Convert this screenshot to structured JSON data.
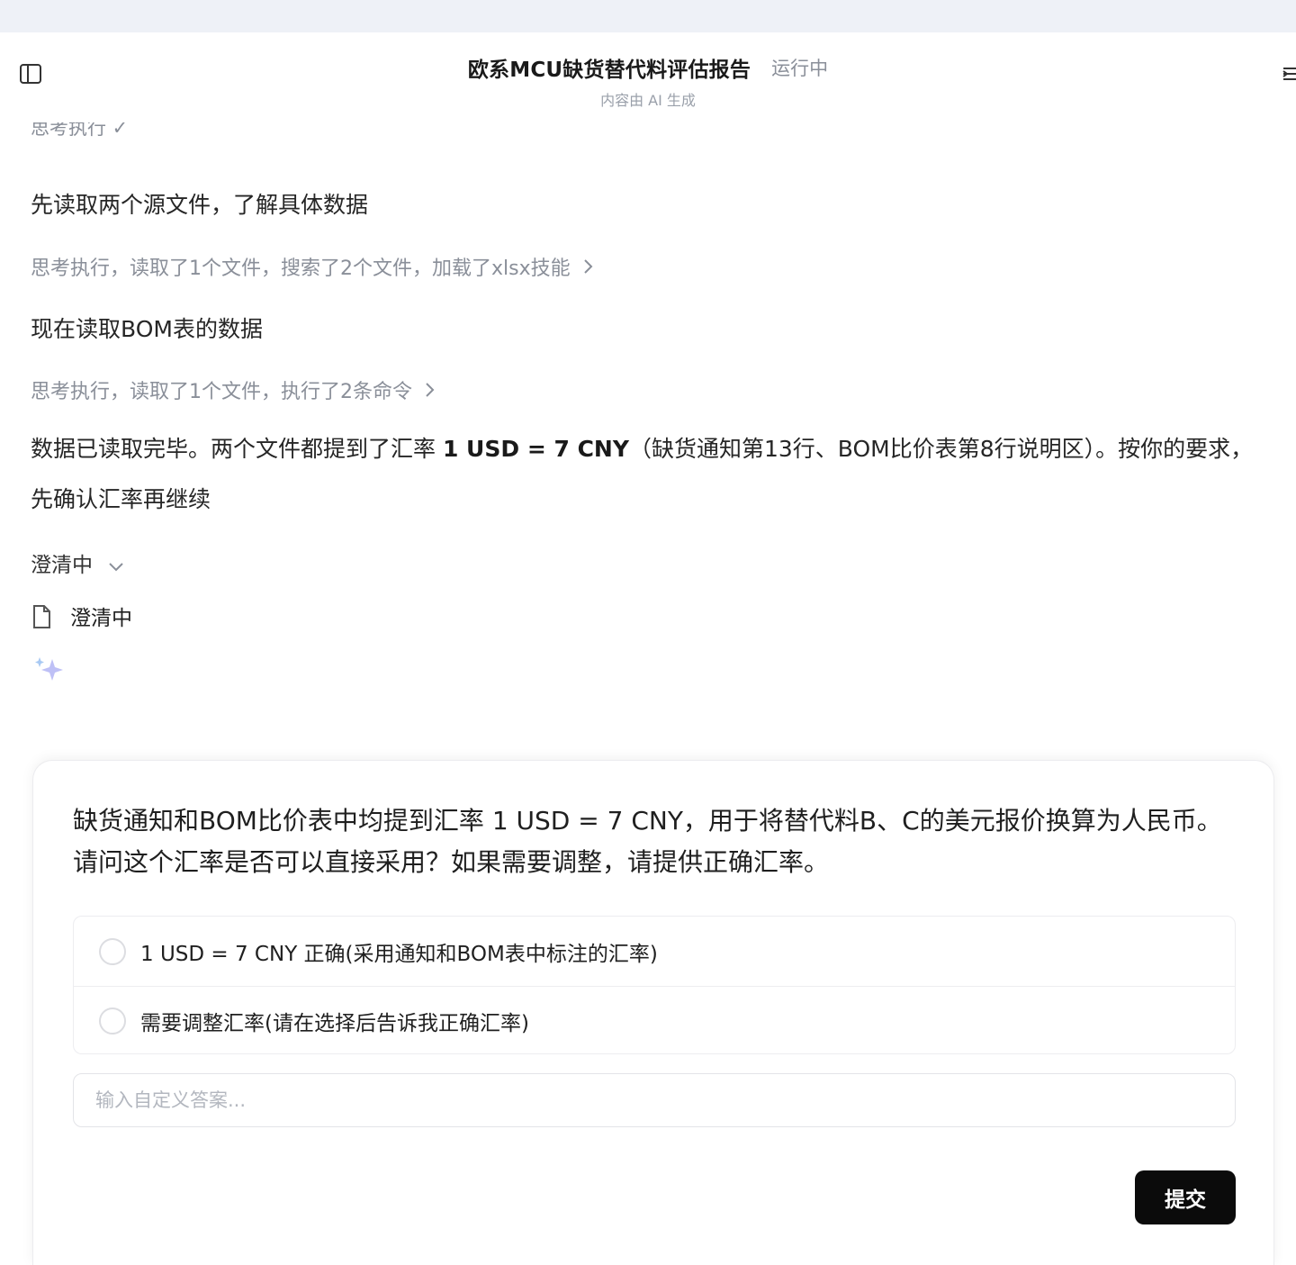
{
  "header": {
    "title": "欧系MCU缺货替代料评估报告",
    "status": "运行中",
    "subtitle": "内容由 AI 生成"
  },
  "chat": {
    "cut_trace": "思考执行 ✓",
    "msg1": "先读取两个源文件，了解具体数据",
    "trace1": "思考执行，读取了1个文件，搜索了2个文件，加载了xlsx技能",
    "msg2": "现在读取BOM表的数据",
    "trace2": "思考执行，读取了1个文件，执行了2条命令",
    "msg3_pre": "数据已读取完毕。两个文件都提到了汇率 ",
    "msg3_bold": "1 USD = 7 CNY",
    "msg3_post": "（缺货通知第13行、BOM比价表第8行说明区）。按你的要求，先确认汇率再继续",
    "clarify_toggle": "澄清中",
    "clarify_file": "澄清中"
  },
  "question_card": {
    "question": "缺货通知和BOM比价表中均提到汇率 1 USD = 7 CNY，用于将替代料B、C的美元报价换算为人民币。请问这个汇率是否可以直接采用？如果需要调整，请提供正确汇率。",
    "options": [
      {
        "label": "1 USD = 7 CNY 正确(采用通知和BOM表中标注的汇率)"
      },
      {
        "label": "需要调整汇率(请在选择后告诉我正确汇率)"
      }
    ],
    "input_placeholder": "输入自定义答案...",
    "submit_label": "提交"
  },
  "icons": {
    "sidebar_toggle": "sidebar-panel-icon",
    "collapse": "collapse-panel-icon",
    "chevron_right": "chevron-right-icon",
    "chevron_down": "chevron-down-icon",
    "document": "document-icon",
    "sparkle": "sparkle-icon"
  },
  "colors": {
    "accent_button": "#0b0b0b",
    "muted_text": "#8a8f99",
    "top_strip": "#eef1f7"
  }
}
